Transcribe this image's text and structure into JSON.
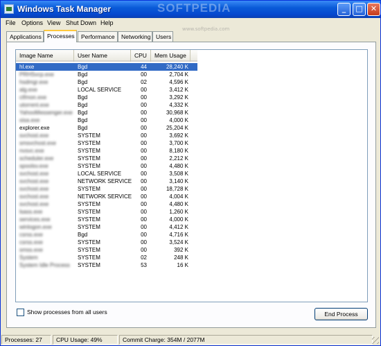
{
  "window": {
    "title": "Windows Task Manager",
    "watermark": "SOFTPEDIA",
    "watermark_url": "www.softpedia.com",
    "controls": {
      "minimize": "_",
      "maximize": "□",
      "close": "✕"
    }
  },
  "menu": [
    "File",
    "Options",
    "View",
    "Shut Down",
    "Help"
  ],
  "tabs": [
    "Applications",
    "Processes",
    "Performance",
    "Networking",
    "Users"
  ],
  "active_tab": "Processes",
  "columns": [
    "Image Name",
    "User Name",
    "CPU",
    "Mem Usage"
  ],
  "rows": [
    {
      "name": "hl.exe",
      "user": "Bgd",
      "cpu": "44",
      "mem": "28,240 K"
    },
    {
      "name": "PRHSvcp.exe",
      "user": "Bgd",
      "cpu": "00",
      "mem": "2,704 K"
    },
    {
      "name": "hsdmgr.exe",
      "user": "Bgd",
      "cpu": "02",
      "mem": "4,596 K"
    },
    {
      "name": "alg.exe",
      "user": "LOCAL SERVICE",
      "cpu": "00",
      "mem": "3,412 K"
    },
    {
      "name": "ctfmon.exe",
      "user": "Bgd",
      "cpu": "00",
      "mem": "3,292 K"
    },
    {
      "name": "utorrent.exe",
      "user": "Bgd",
      "cpu": "00",
      "mem": "4,332 K"
    },
    {
      "name": "YahooMessenger.exe",
      "user": "Bgd",
      "cpu": "00",
      "mem": "30,968 K"
    },
    {
      "name": "sisa.exe",
      "user": "Bgd",
      "cpu": "00",
      "mem": "4,000 K"
    },
    {
      "name": "explorer.exe",
      "user": "Bgd",
      "cpu": "00",
      "mem": "25,204 K"
    },
    {
      "name": "svchost.exe",
      "user": "SYSTEM",
      "cpu": "00",
      "mem": "3,692 K"
    },
    {
      "name": "smsvchost.exe",
      "user": "SYSTEM",
      "cpu": "00",
      "mem": "3,700 K"
    },
    {
      "name": "nvsvc.exe",
      "user": "SYSTEM",
      "cpu": "00",
      "mem": "8,180 K"
    },
    {
      "name": "scheduler.exe",
      "user": "SYSTEM",
      "cpu": "00",
      "mem": "2,212 K"
    },
    {
      "name": "spoolsv.exe",
      "user": "SYSTEM",
      "cpu": "00",
      "mem": "4,480 K"
    },
    {
      "name": "svchost.exe",
      "user": "LOCAL SERVICE",
      "cpu": "00",
      "mem": "3,508 K"
    },
    {
      "name": "svchost.exe",
      "user": "NETWORK SERVICE",
      "cpu": "00",
      "mem": "3,140 K"
    },
    {
      "name": "svchost.exe",
      "user": "SYSTEM",
      "cpu": "00",
      "mem": "18,728 K"
    },
    {
      "name": "svchost.exe",
      "user": "NETWORK SERVICE",
      "cpu": "00",
      "mem": "4,004 K"
    },
    {
      "name": "svchost.exe",
      "user": "SYSTEM",
      "cpu": "00",
      "mem": "4,480 K"
    },
    {
      "name": "lsass.exe",
      "user": "SYSTEM",
      "cpu": "00",
      "mem": "1,260 K"
    },
    {
      "name": "services.exe",
      "user": "SYSTEM",
      "cpu": "00",
      "mem": "4,000 K"
    },
    {
      "name": "winlogon.exe",
      "user": "SYSTEM",
      "cpu": "00",
      "mem": "4,412 K"
    },
    {
      "name": "csrss.exe",
      "user": "Bgd",
      "cpu": "00",
      "mem": "4,716 K"
    },
    {
      "name": "csrss.exe",
      "user": "SYSTEM",
      "cpu": "00",
      "mem": "3,524 K"
    },
    {
      "name": "smss.exe",
      "user": "SYSTEM",
      "cpu": "00",
      "mem": "392 K"
    },
    {
      "name": "System",
      "user": "SYSTEM",
      "cpu": "02",
      "mem": "248 K"
    },
    {
      "name": "System Idle Process",
      "user": "SYSTEM",
      "cpu": "53",
      "mem": "16 K"
    }
  ],
  "show_all_users_label": "Show processes from all users",
  "end_process_label": "End Process",
  "status": {
    "processes": "Processes: 27",
    "cpu": "CPU Usage: 49%",
    "commit": "Commit Charge: 354M / 2077M"
  }
}
